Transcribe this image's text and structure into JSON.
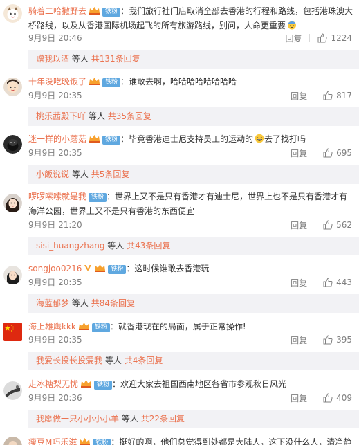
{
  "labels": {
    "reply": "回复",
    "others_prefix": "等人",
    "fan_badge": "铁粉"
  },
  "colors": {
    "username": "#eb7350",
    "link": "#eb7350",
    "fan_badge": "#5fa8e0",
    "reply_bg": "#f2f2f5",
    "meta": "#808080"
  },
  "comments": [
    {
      "username": "骑着二哈撒野去",
      "text": "：我们旅行社门店取消全部去香港的行程和路线，包括港珠澳大桥路线，以及从香港国际机场起飞的所有旅游路线，别问，人命更重要",
      "emoji": "sweat-emoji",
      "time": "9月9日 20:46",
      "likes": "1224",
      "reply_user": "赠我以酒",
      "reply_count": "共131条回复"
    },
    {
      "username": "十年没吃晚饭了",
      "text": "：谁敢去啊，哈哈哈哈哈哈哈哈",
      "time": "9月9日 20:35",
      "likes": "817",
      "reply_user": "桃乐茜殿下吖",
      "reply_count": "共35条回复"
    },
    {
      "username": "迷一样的小蘑菇",
      "text": "：毕竟香港迪士尼支持员工的运动的",
      "emoji": "grin-emoji",
      "text_after": "去了找打吗",
      "time": "9月9日 20:35",
      "likes": "695",
      "reply_user": "小飯说说",
      "reply_count": "共5条回复"
    },
    {
      "username": "啰啰嗦嗦就是我",
      "text": "：世界上又不是只有香港才有迪士尼，世界上也不是只有香港才有海洋公园，世界上又不是只有香港的东西便宜",
      "time": "9月9日 21:20",
      "likes": "562",
      "reply_user": "sisi_huangzhang",
      "reply_count": "共43条回复"
    },
    {
      "username": "songjoo0216",
      "text": "：这时候谁敢去香港玩",
      "time": "9月9日 20:35",
      "likes": "443",
      "reply_user": "海蓝郁梦",
      "reply_count": "共84条回复"
    },
    {
      "username": "海上雄鹰kkk",
      "text": "：就香港现在的局面，属于正常操作!",
      "time": "9月9日 20:35",
      "likes": "395",
      "reply_user": "我爱长投长投爱我",
      "reply_count": "共4条回复"
    },
    {
      "username": "走冰糖梨无忧",
      "text": "：欢迎大家去祖国西南地区各省市参观秋日风光",
      "time": "9月9日 20:36",
      "likes": "409",
      "reply_user": "我愿做一只小小小小羊",
      "reply_count": "共22条回复"
    }
  ],
  "partial_comment": {
    "username": "瘦豆M巧乐滋",
    "text": "：挺好的啊，他们总觉得到处都是大陆人，这下没什么人，清净静"
  }
}
